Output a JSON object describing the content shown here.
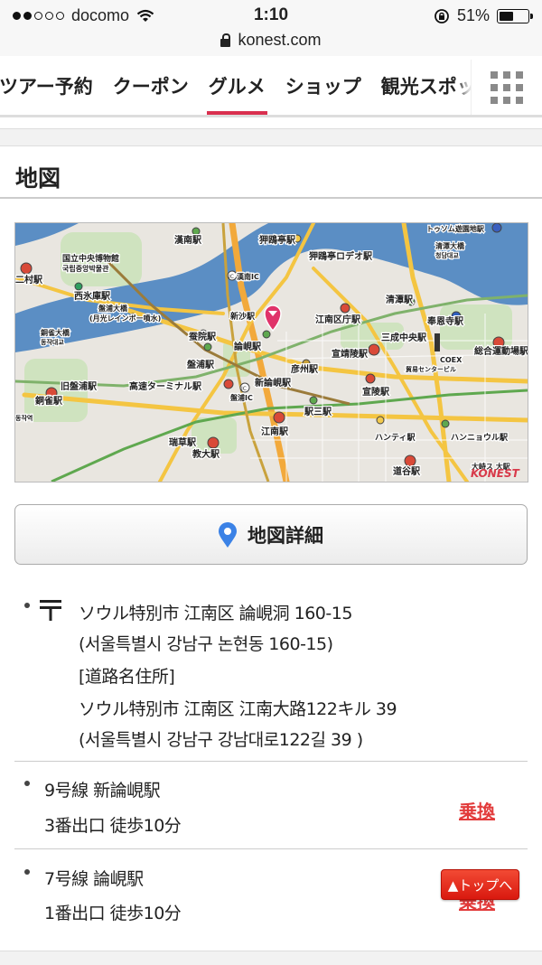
{
  "status_bar": {
    "carrier": "docomo",
    "time": "1:10",
    "battery": "51%",
    "battery_level": 0.51
  },
  "browser": {
    "url": "konest.com"
  },
  "tabs": [
    {
      "label": "ツアー予約"
    },
    {
      "label": "クーポン"
    },
    {
      "label": "グルメ",
      "active": true
    },
    {
      "label": "ショップ"
    },
    {
      "label": "観光スポット"
    }
  ],
  "section": {
    "title": "地図"
  },
  "map": {
    "watermark": "KONEST",
    "labels": {
      "hannam": "漢南駅",
      "apgujeong": "狎鴎亭駅",
      "apgujeong_rodeo": "狎鴎亭ロデオ駅",
      "tourism": "トゥソム遊園地駅",
      "cheongdam_bridge": "清潭大橋",
      "cheongdam_bridge_kr": "청담대교",
      "museum": "国立中央博物館",
      "museum_kr": "국립중앙박물관",
      "ichon": "二村駅",
      "seobinggo": "西氷庫駅",
      "banpo_bridge": "盤浦大橋",
      "banpo_bridge_sub": "(月光レインボー噴水)",
      "hannam_ic": "漢南IC",
      "sinsa": "新沙駅",
      "gangnam_gu_office": "江南区庁駅",
      "cheongdam": "清潭駅",
      "bongeunsa": "奉恩寺駅",
      "jamsil_bridge": "銅雀大橋",
      "jamsil_bridge_kr": "동작대교",
      "jamwon": "蚕院駅",
      "nonhyeon": "論峴駅",
      "seonjeongneung": "宣靖陵駅",
      "samseong_jungang": "三成中央駅",
      "sports": "総合運動場駅",
      "banpo": "盤浦駅",
      "sinnonhyeon": "新論峴駅",
      "eonju": "彦州駅",
      "coex": "COEX",
      "wtc": "貿易センタービル",
      "old_banpo": "旧盤浦駅",
      "express_terminal": "高速ターミナル駅",
      "banpo_ic": "盤浦IC",
      "seolleung": "宣陵駅",
      "dongjak": "銅雀駅",
      "yeoksam": "駅三駅",
      "dongjak_kr": "동작역",
      "hanti": "ハンティ駅",
      "hanyang_univ": "ハンニョウル駅",
      "gangnam": "江南駅",
      "seocho": "瑞草駅",
      "kyodae": "教大駅",
      "dogok": "道谷駅",
      "daemo": "大峙ス 大駅"
    }
  },
  "detail_button": {
    "label": "地図詳細"
  },
  "address": {
    "postal_symbol": "〒",
    "line1": "ソウル特別市 江南区 論峴洞 160-15",
    "line2": "(서울특별시 강남구 논현동 160-15)",
    "line3": "[道路名住所]",
    "line4": "ソウル特別市 江南区 江南大路122キル 39",
    "line5": "(서울특별시 강남구 강남대로122길 39 )"
  },
  "access": [
    {
      "line": "9号線 新論峴駅",
      "exit": "3番出口 徒歩10分",
      "link": "乗換"
    },
    {
      "line": "7号線 論峴駅",
      "exit": "1番出口 徒歩10分",
      "link": "乗換"
    }
  ],
  "to_top": {
    "label": "▲トップへ"
  },
  "colors": {
    "accent": "#d9304f",
    "link": "#e23b3b",
    "top_button": "#e5281c",
    "pin": "#e0336a",
    "map_water": "#5b8ec4",
    "map_land": "#e9e6e0"
  },
  "icons": {
    "wifi": "wifi-icon",
    "lock": "lock-icon",
    "grid": "grid-menu-icon",
    "pin": "map-pin-icon",
    "postal": "postal-mark-icon"
  }
}
